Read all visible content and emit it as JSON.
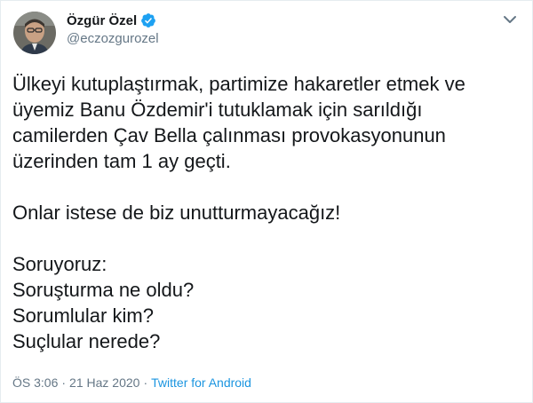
{
  "tweet": {
    "author": {
      "display_name": "Özgür Özel",
      "handle": "@eczozgurozel",
      "verified": true,
      "verified_color": "#1da1f2"
    },
    "text_lines": [
      "Ülkeyi kutuplaştırmak, partimize hakaretler etmek ve",
      "üyemiz Banu Özdemir'i tutuklamak için sarıldığı",
      "camilerden Çav Bella çalınması provokasyonunun",
      "üzerinden tam 1 ay geçti.",
      "",
      "Onlar istese de biz unutturmayacağız!",
      "",
      "Soruyoruz:",
      "Soruşturma ne oldu?",
      "Sorumlular kim?",
      "Suçlular nerede?"
    ],
    "timestamp_time": "ÖS 3:06",
    "separator": "·",
    "timestamp_date": "21 Haz 2020",
    "source": "Twitter for Android",
    "icons": {
      "menu": "chevron-down-icon",
      "verified": "verified-badge-icon"
    },
    "colors": {
      "text": "#14171a",
      "secondary": "#657786",
      "link": "#1b95e0"
    }
  }
}
